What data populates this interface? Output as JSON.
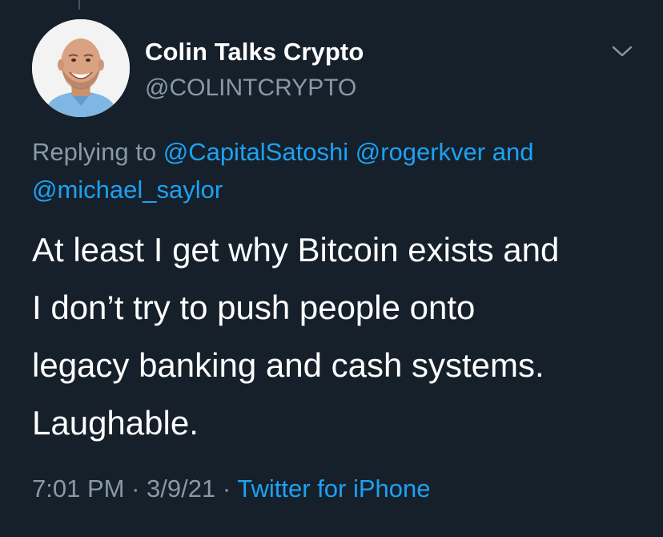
{
  "author": {
    "display_name": "Colin Talks Crypto",
    "handle": "@COLINTCRYPTO",
    "avatar_icon": "person-photo-avatar"
  },
  "menu_icon": "chevron-down-icon",
  "reply": {
    "prefix": "Replying to",
    "mentions": [
      "@CapitalSatoshi",
      "@rogerkver",
      "@michael_saylor"
    ],
    "conjunction": "and"
  },
  "tweet": {
    "lines": [
      "At least I get why Bitcoin exists and",
      "I don’t try to push people onto",
      "legacy banking and cash systems.",
      "Laughable."
    ]
  },
  "meta": {
    "time": "7:01 PM",
    "separator": "·",
    "date": "3/9/21",
    "source": "Twitter for iPhone"
  },
  "colors": {
    "background": "#15202b",
    "text": "#ffffff",
    "secondary": "#8899a6",
    "link": "#1da1f2"
  }
}
